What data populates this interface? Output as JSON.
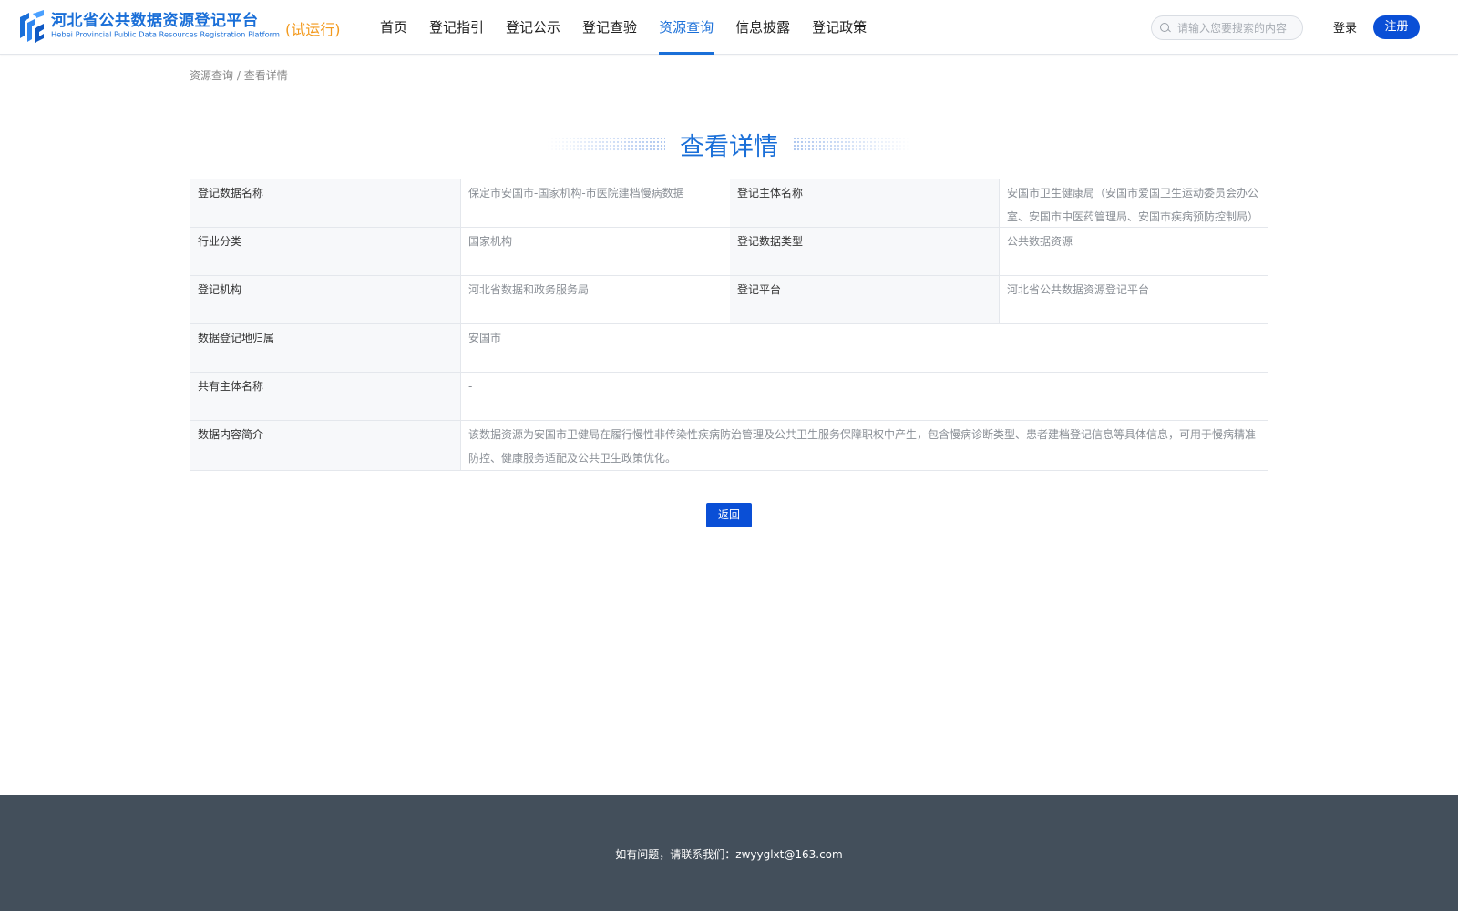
{
  "header": {
    "logo_cn": "河北省公共数据资源登记平台",
    "logo_en": "Hebei Provincial Public Data Resources Registration Platform",
    "logo_trial": "(试运行)",
    "nav": [
      {
        "label": "首页"
      },
      {
        "label": "登记指引"
      },
      {
        "label": "登记公示"
      },
      {
        "label": "登记查验"
      },
      {
        "label": "资源查询",
        "active": true
      },
      {
        "label": "信息披露"
      },
      {
        "label": "登记政策"
      }
    ],
    "search_placeholder": "请输入您要搜索的内容",
    "login_label": "登录",
    "register_label": "注册",
    "accent_color": "#1a6fd8",
    "button_color": "#0a4fd6",
    "trial_color": "#f39a1e"
  },
  "breadcrumb": {
    "parent": "资源查询",
    "separator": "/",
    "current": "查看详情"
  },
  "page_title": "查看详情",
  "details": {
    "data_name_label": "登记数据名称",
    "data_name_value": "保定市安国市-国家机构-市医院建档慢病数据",
    "subject_name_label": "登记主体名称",
    "subject_name_value": "安国市卫生健康局（安国市爱国卫生运动委员会办公室、安国市中医药管理局、安国市疾病预防控制局）",
    "industry_label": "行业分类",
    "industry_value": "国家机构",
    "data_type_label": "登记数据类型",
    "data_type_value": "公共数据资源",
    "agency_label": "登记机构",
    "agency_value": "河北省数据和政务服务局",
    "platform_label": "登记平台",
    "platform_value": "河北省公共数据资源登记平台",
    "location_label": "数据登记地归属",
    "location_value": "安国市",
    "co_owner_label": "共有主体名称",
    "co_owner_value": "-",
    "summary_label": "数据内容简介",
    "summary_value": "该数据资源为安国市卫健局在履行慢性非传染性疾病防治管理及公共卫生服务保障职权中产生，包含慢病诊断类型、患者建档登记信息等具体信息，可用于慢病精准防控、健康服务适配及公共卫生政策优化。"
  },
  "back_label": "返回",
  "footer": {
    "contact_text": "如有问题，请联系我们：zwyyglxt@163.com",
    "background": "#434f5b"
  }
}
